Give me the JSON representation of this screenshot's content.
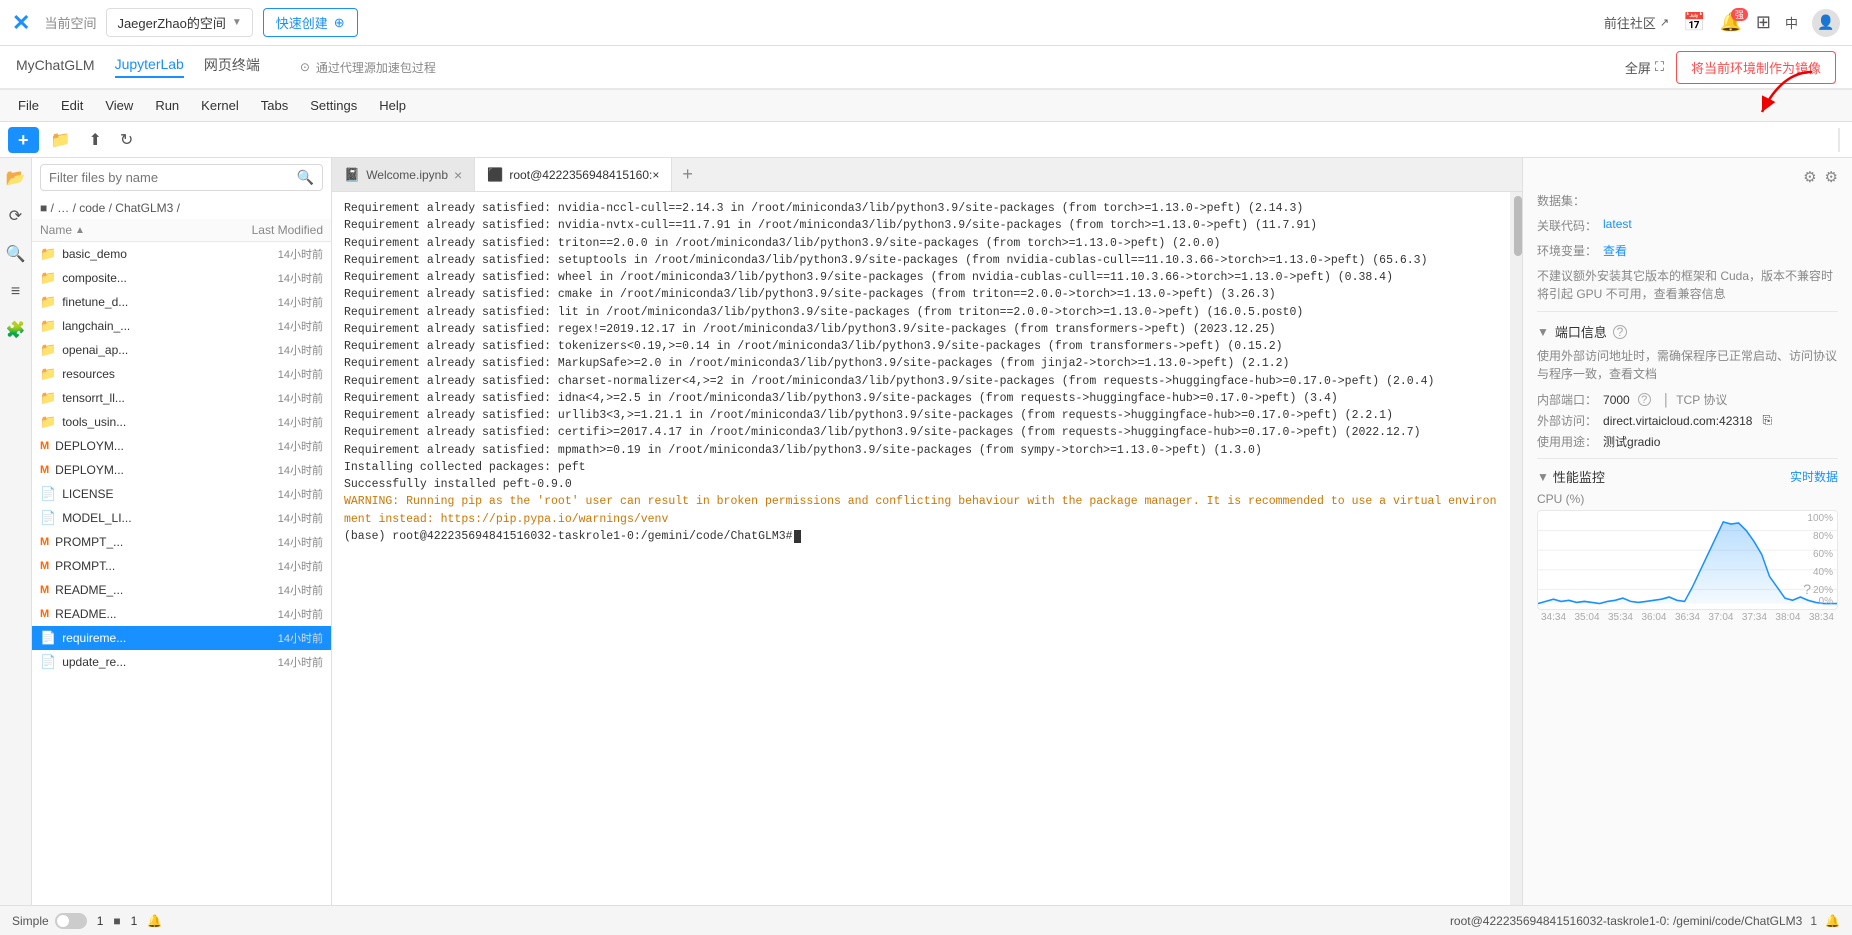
{
  "topNav": {
    "logo": "✕",
    "currentSpaceLabel": "当前空间",
    "spaceName": "JaegerZhao的空间",
    "quickCreateLabel": "快速创建",
    "communityLabel": "前往社区",
    "badgeText": "强",
    "langLabel": "中"
  },
  "subNav": {
    "tabs": [
      "MyChatGLM",
      "JupyterLab",
      "网页终端"
    ],
    "activeTab": 1,
    "proxyTab": "通过代理源加速包过程",
    "fullscreenLabel": "全屏",
    "makeImageLabel": "将当前环境制作为镜像"
  },
  "menuBar": {
    "items": [
      "File",
      "Edit",
      "View",
      "Run",
      "Kernel",
      "Tabs",
      "Settings",
      "Help"
    ]
  },
  "filePanel": {
    "searchPlaceholder": "Filter files by name",
    "breadcrumb": "■ / … / code / ChatGLM3 /",
    "headers": {
      "name": "Name",
      "sortIndicator": "▲",
      "lastModified": "Last Modified"
    },
    "files": [
      {
        "type": "folder",
        "name": "basic_demo",
        "date": "14小时前"
      },
      {
        "type": "folder",
        "name": "composite...",
        "date": "14小时前"
      },
      {
        "type": "folder",
        "name": "finetune_d...",
        "date": "14小时前"
      },
      {
        "type": "folder",
        "name": "langchain_...",
        "date": "14小时前"
      },
      {
        "type": "folder",
        "name": "openai_ap...",
        "date": "14小时前"
      },
      {
        "type": "folder",
        "name": "resources",
        "date": "14小时前"
      },
      {
        "type": "folder",
        "name": "tensorrt_ll...",
        "date": "14小时前"
      },
      {
        "type": "folder",
        "name": "tools_usin...",
        "date": "14小时前"
      },
      {
        "type": "md",
        "name": "DEPLOYM...",
        "date": "14小时前"
      },
      {
        "type": "md",
        "name": "DEPLOYM...",
        "date": "14小时前"
      },
      {
        "type": "file",
        "name": "LICENSE",
        "date": "14小时前"
      },
      {
        "type": "file",
        "name": "MODEL_LI...",
        "date": "14小时前"
      },
      {
        "type": "md",
        "name": "PROMPT_...",
        "date": "14小时前"
      },
      {
        "type": "md",
        "name": "PROMPT...",
        "date": "14小时前"
      },
      {
        "type": "md",
        "name": "README_...",
        "date": "14小时前"
      },
      {
        "type": "md",
        "name": "README...",
        "date": "14小时前"
      },
      {
        "type": "file",
        "name": "requireme...",
        "date": "14小时前",
        "selected": true
      },
      {
        "type": "file",
        "name": "update_re...",
        "date": "14小时前"
      }
    ]
  },
  "tabs": {
    "items": [
      {
        "icon": "📓",
        "label": "Welcome.ipynb",
        "active": false
      },
      {
        "icon": "⬛",
        "label": "root@4222356948415160:×",
        "active": true
      }
    ]
  },
  "terminal": {
    "lines": [
      "Requirement already satisfied: nvidia-nccl-cull==2.14.3 in /root/miniconda3/lib/python3.9/site-packages (from torch>=1.13.0->peft) (2.14.3)",
      "Requirement already satisfied: nvidia-nvtx-cull==11.7.91 in /root/miniconda3/lib/python3.9/site-packages (from torch>=1.13.0->peft) (11.7.91)",
      "Requirement already satisfied: triton==2.0.0 in /root/miniconda3/lib/python3.9/site-packages (from torch>=1.13.0->peft) (2.0.0)",
      "Requirement already satisfied: setuptools in /root/miniconda3/lib/python3.9/site-packages (from nvidia-cublas-cull==11.10.3.66->torch>=1.13.0->peft) (65.6.3)",
      "Requirement already satisfied: wheel in /root/miniconda3/lib/python3.9/site-packages (from nvidia-cublas-cull==11.10.3.66->torch>=1.13.0->peft) (0.38.4)",
      "Requirement already satisfied: cmake in /root/miniconda3/lib/python3.9/site-packages (from triton==2.0.0->torch>=1.13.0->peft) (3.26.3)",
      "Requirement already satisfied: lit in /root/miniconda3/lib/python3.9/site-packages (from triton==2.0.0->torch>=1.13.0->peft) (16.0.5.post0)",
      "Requirement already satisfied: regex!=2019.12.17 in /root/miniconda3/lib/python3.9/site-packages (from transformers->peft) (2023.12.25)",
      "Requirement already satisfied: tokenizers<0.19,>=0.14 in /root/miniconda3/lib/python3.9/site-packages (from transformers->peft) (0.15.2)",
      "Requirement already satisfied: MarkupSafe>=2.0 in /root/miniconda3/lib/python3.9/site-packages (from jinja2->torch>=1.13.0->peft) (2.1.2)",
      "Requirement already satisfied: charset-normalizer<4,>=2 in /root/miniconda3/lib/python3.9/site-packages (from requests->huggingface-hub>=0.17.0->peft) (2.0.4)",
      "Requirement already satisfied: idna<4,>=2.5 in /root/miniconda3/lib/python3.9/site-packages (from requests->huggingface-hub>=0.17.0->peft) (3.4)",
      "Requirement already satisfied: urllib3<3,>=1.21.1 in /root/miniconda3/lib/python3.9/site-packages (from requests->huggingface-hub>=0.17.0->peft) (2.2.1)",
      "Requirement already satisfied: certifi>=2017.4.17 in /root/miniconda3/lib/python3.9/site-packages (from requests->huggingface-hub>=0.17.0->peft) (2022.12.7)",
      "Requirement already satisfied: mpmath>=0.19 in /root/miniconda3/lib/python3.9/site-packages (from sympy->torch>=1.13.0->peft) (1.3.0)",
      "Installing collected packages: peft",
      "Successfully installed peft-0.9.0"
    ],
    "warnLine": "WARNING: Running pip as the 'root' user can result in broken permissions and conflicting behaviour with the package manager. It is recommended to use a virtual environment instead: https://pip.pypa.io/warnings/venv",
    "promptLine": "(base) root@42223569484151603​2-taskrole1-0:/gemini/code/ChatGLM3#"
  },
  "rightPanel": {
    "dataEditorLabel": "数据集：",
    "relatedCodeLabel": "关联代码：",
    "relatedCodeValue": "latest",
    "envVarLabel": "环境变量：",
    "envVarLink": "查看",
    "envWarning": "不建议额外安装其它版本的框架和 Cuda，版本不兼容时将引起 GPU 不可用，查看兼容信息",
    "portSectionLabel": "端口信息",
    "portDesc": "使用外部访问地址时，需确保程序已正常启动、访问协议与程序一致，查看文档",
    "internalPortLabel": "内部端口：",
    "internalPortValue": "7000",
    "protocol": "TCP 协议",
    "externalLabel": "外部访问：",
    "externalValue": "direct.virtaicloud.com:42318",
    "usageLabel": "使用用途：",
    "usageValue": "测试gradio",
    "perfSectionLabel": "性能监控",
    "realtimeLabel": "实时数据",
    "cpuLabel": "CPU (%)",
    "cpuMax": "100%",
    "cpuValues": [
      5,
      8,
      12,
      6,
      10,
      8,
      5,
      7,
      4,
      6,
      8,
      10,
      5,
      4,
      6,
      7,
      9,
      12,
      8,
      6,
      20,
      35,
      50,
      70,
      90,
      85,
      88,
      75,
      60,
      40,
      25,
      15,
      8,
      10,
      12,
      8,
      6,
      5,
      4,
      3
    ],
    "timeLabels": [
      "34:34",
      "35:04",
      "35:34",
      "36:04",
      "36:34",
      "37:04",
      "37:34",
      "38:04",
      "38:34"
    ]
  },
  "statusBar": {
    "simpleLabel": "Simple",
    "count1": "1",
    "icon1": "■",
    "count2": "1",
    "rightText": "root@42223569484​15160​32-taskrole1-0: /gemini/code/ChatGLM3",
    "notifCount": "1"
  }
}
